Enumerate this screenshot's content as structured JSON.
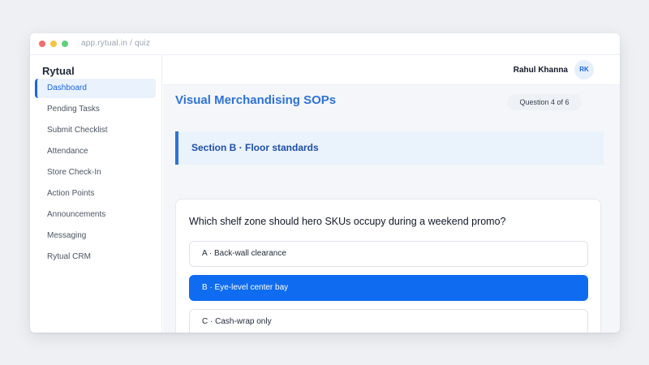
{
  "browser": {
    "url": "app.rytual.in / quiz"
  },
  "sidebar": {
    "brand": "Rytual",
    "items": [
      {
        "label": "Dashboard",
        "active": true
      },
      {
        "label": "Pending Tasks"
      },
      {
        "label": "Submit Checklist"
      },
      {
        "label": "Attendance"
      },
      {
        "label": "Store Check-In"
      },
      {
        "label": "Action Points"
      },
      {
        "label": "Announcements"
      },
      {
        "label": "Messaging"
      },
      {
        "label": "Rytual CRM"
      }
    ]
  },
  "header": {
    "user_name": "Rahul Khanna",
    "avatar_initials": "RK"
  },
  "quiz": {
    "title": "Visual Merchandising SOPs",
    "progress": "Question 4 of 6",
    "section": "Section B · Floor standards",
    "question": "Which shelf zone should hero SKUs occupy during a weekend promo?",
    "options": [
      {
        "label": "A · Back-wall clearance"
      },
      {
        "label": "B · Eye-level center bay",
        "selected": true
      },
      {
        "label": "C · Cash-wrap only"
      }
    ]
  },
  "colors": {
    "accent": "#0f6cf0",
    "title": "#2f72d6",
    "banner": "#eaf2fb"
  }
}
